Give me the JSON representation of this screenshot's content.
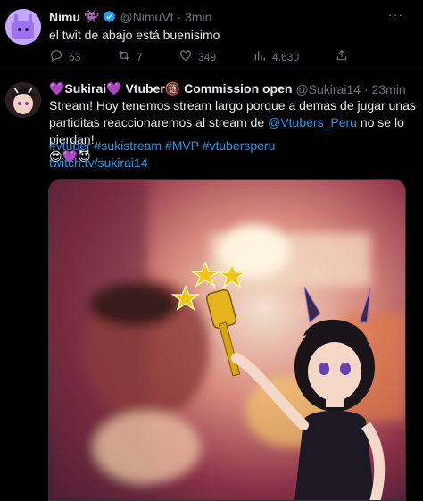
{
  "tweet1": {
    "author_name": "Nimu",
    "author_emoji": "👾",
    "handle": "@NimuVt",
    "time": "3min",
    "text": "el twit de abajo está buenisimo",
    "replies": "63",
    "retweets": "7",
    "likes": "349",
    "views": "4.630",
    "more": "···"
  },
  "tweet2": {
    "author_name": "💜Sukirai💜 Vtuber🔞 Commission open",
    "handle": "@Sukirai14",
    "time": "· 23min",
    "line1": "Stream! Hoy tenemos stream largo porque a demas de jugar unas",
    "line2a": "partiditas reaccionaremos al stream de ",
    "mention": "@Vtubers_Peru",
    "line2b": " no se lo pierdan!",
    "line3": "😎💜😈",
    "hashtags": "#vtuber #sukistream #MVP #vtubersperu",
    "link": "twitch.tv/sukirai14",
    "more": "···"
  },
  "colors": {
    "accent": "#1d9bf0",
    "muted": "#71767b",
    "verified_gold": "#e2b719"
  },
  "icons": [
    "verified-badge-icon",
    "reply-icon",
    "retweet-icon",
    "like-icon",
    "views-icon",
    "share-icon",
    "more-icon"
  ]
}
